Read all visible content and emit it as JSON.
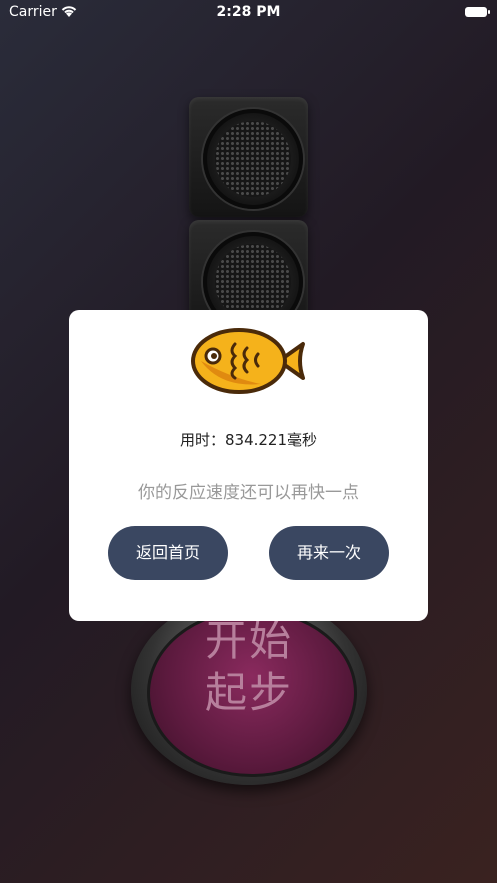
{
  "status_bar": {
    "carrier": "Carrier",
    "time": "2:28 PM"
  },
  "start_button": {
    "line1": "开始",
    "line2": "起步"
  },
  "result_dialog": {
    "time_label": "用时：834.221毫秒",
    "message": "你的反应速度还可以再快一点",
    "home_button": "返回首页",
    "retry_button": "再来一次"
  },
  "icons": {
    "fish": "fish-icon",
    "wifi": "wifi-icon",
    "battery": "battery-icon"
  },
  "colors": {
    "button_bg": "#3a4761",
    "fish_body": "#f5b21b",
    "start_face": "#7a2452"
  }
}
